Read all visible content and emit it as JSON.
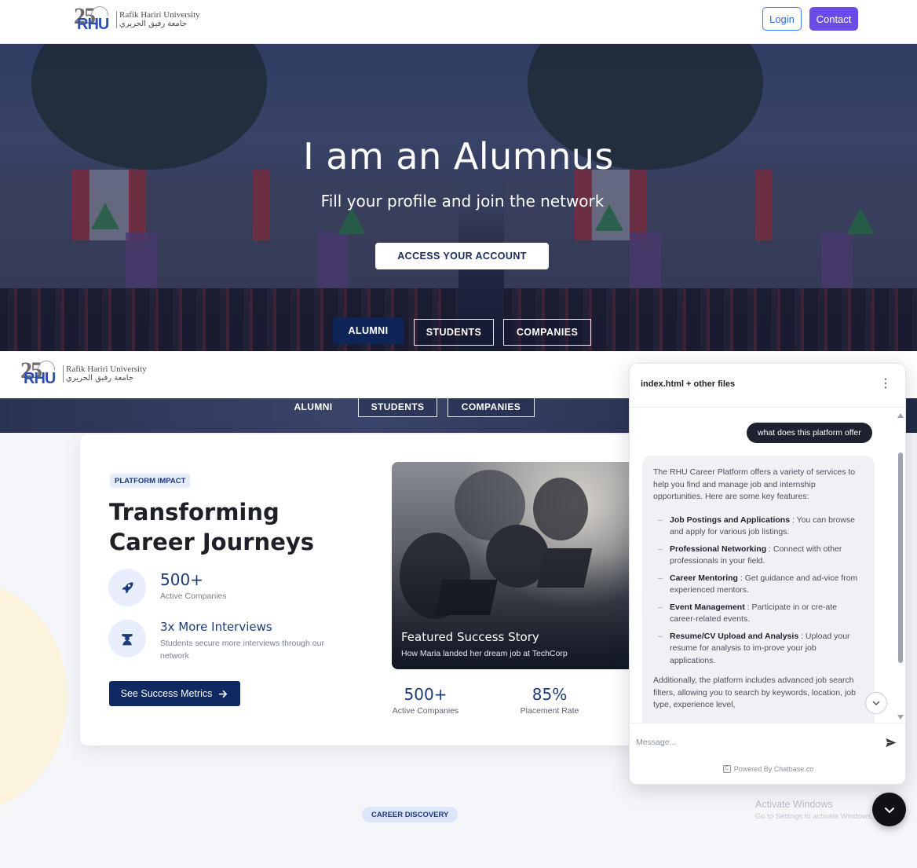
{
  "header": {
    "logo_en": "Rafik Hariri University",
    "logo_ar": "جامعة رفيق الحريري",
    "logo_badge": "25",
    "logo_mark": "RHU",
    "login_label": "Login",
    "contact_label": "Contact"
  },
  "hero": {
    "title": "I am an Alumnus",
    "subtitle": "Fill your profile and join the network",
    "cta_label": "ACCESS YOUR ACCOUNT",
    "tabs": [
      {
        "label": "ALUMNI",
        "active": true
      },
      {
        "label": "STUDENTS",
        "active": false
      },
      {
        "label": "COMPANIES",
        "active": false
      }
    ]
  },
  "impact": {
    "pill": "PLATFORM IMPACT",
    "title": "Transforming Career Journeys",
    "stat1_value": "500+",
    "stat1_label": "Active Companies",
    "stat1_icon": "rocket-icon",
    "stat2_value": "3x More Interviews",
    "stat2_label": "Students secure more interviews through our network",
    "stat2_icon": "graduate-icon",
    "button_label": "See Success Metrics",
    "story_title": "Featured Success Story",
    "story_sub": "How Maria landed her dream job at TechCorp",
    "kpis": [
      {
        "value": "500+",
        "label": "Active Companies"
      },
      {
        "value": "85%",
        "label": "Placement Rate"
      }
    ]
  },
  "career_pill": "CAREER DISCOVERY",
  "chat": {
    "title": "index.html + other files",
    "user_message": "what does this platform offer",
    "bot_intro": "The RHU Career Platform offers a variety of services to help you find and manage job and internship opportunities. Here are some key features:",
    "features": [
      {
        "name": "Job Postings and Applications",
        "desc": ": You can browse and apply for various job listings."
      },
      {
        "name": "Professional Networking",
        "desc": ": Connect with other professionals in your field."
      },
      {
        "name": "Career Mentoring",
        "desc": ": Get guidance and ad-vice from experienced mentors."
      },
      {
        "name": "Event Management",
        "desc": ": Participate in or cre-ate career-related events."
      },
      {
        "name": "Resume/CV Upload and Analysis",
        "desc": ": Upload your resume for analysis to im-prove your job applications."
      }
    ],
    "bot_outro": "Additionally, the platform includes advanced job search filters, allowing you to search by keywords, location, job type, experience level,",
    "input_placeholder": "Message...",
    "powered_by": "Powered By Chatbase.co"
  },
  "watermark": {
    "line1": "Activate Windows",
    "line2": "Go to Settings to activate Windows."
  },
  "colors": {
    "brand_navy": "#0f2557",
    "contact_purple": "#6a4ce8",
    "login_blue": "#3b82f6"
  }
}
